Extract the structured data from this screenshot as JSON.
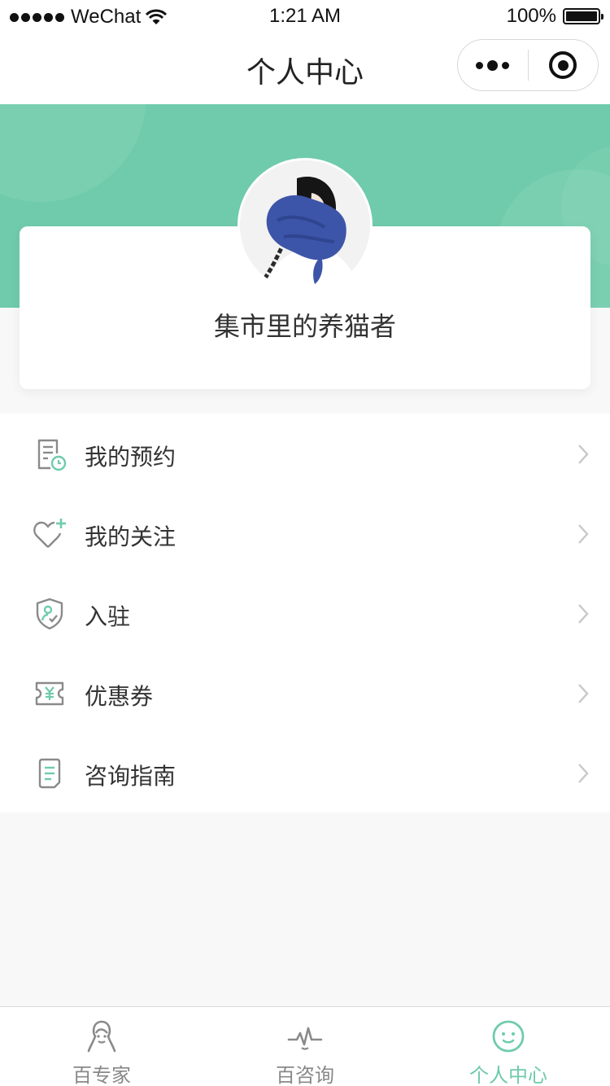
{
  "status_bar": {
    "carrier": "WeChat",
    "time": "1:21 AM",
    "battery": "100%"
  },
  "nav": {
    "title": "个人中心"
  },
  "profile": {
    "username": "集市里的养猫者"
  },
  "menu": {
    "items": [
      {
        "label": "我的预约",
        "icon": "appointment-icon"
      },
      {
        "label": "我的关注",
        "icon": "heart-plus-icon"
      },
      {
        "label": "入驻",
        "icon": "shield-user-icon"
      },
      {
        "label": "优惠券",
        "icon": "coupon-icon"
      },
      {
        "label": "咨询指南",
        "icon": "guide-document-icon"
      }
    ]
  },
  "tabbar": {
    "items": [
      {
        "label": "百专家",
        "icon": "expert-icon",
        "active": false
      },
      {
        "label": "百咨询",
        "icon": "pulse-icon",
        "active": false
      },
      {
        "label": "个人中心",
        "icon": "smiley-icon",
        "active": true
      }
    ]
  },
  "colors": {
    "accent": "#6fcbab",
    "icon_gray": "#8a8a8a",
    "text": "#333333",
    "inactive_tab": "#888888"
  }
}
